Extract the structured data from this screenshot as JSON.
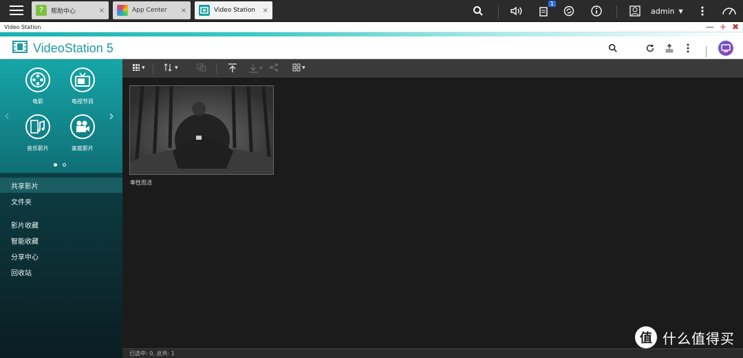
{
  "topbar": {
    "tabs": [
      {
        "label": "帮助中心",
        "close": "×",
        "icon": "help-center-icon"
      },
      {
        "label": "App Center",
        "close": "×",
        "icon": "app-center-icon"
      },
      {
        "label": "Video Station",
        "close": "×",
        "icon": "video-station-icon"
      }
    ],
    "notification_count": "1",
    "user": "admin"
  },
  "window": {
    "title": "Video Station",
    "min": "—",
    "max": "+",
    "close": "✖"
  },
  "app": {
    "title": "VideoStation 5"
  },
  "sidebar": {
    "categories": [
      {
        "label": "电影",
        "icon": "film-reel-icon"
      },
      {
        "label": "电视节目",
        "icon": "tv-icon"
      },
      {
        "label": "音乐影片",
        "icon": "music-video-icon"
      },
      {
        "label": "家庭影片",
        "icon": "video-camera-icon"
      }
    ],
    "menu": [
      {
        "label": "共享影片",
        "active": true
      },
      {
        "label": "文件夹"
      },
      {
        "label": "影片收藏"
      },
      {
        "label": "智能收藏"
      },
      {
        "label": "分享中心"
      },
      {
        "label": "回收站"
      }
    ]
  },
  "content": {
    "items": [
      {
        "caption": "率性而活"
      }
    ]
  },
  "status": {
    "text": "已选中: 0, 总共: 1"
  },
  "watermark": {
    "logo": "值",
    "text": "什么值得买"
  },
  "colors": {
    "accent": "#1e9aa6",
    "topbar": "#2b2b2b",
    "sidebar_top": "#16a6a8",
    "content_bg": "#1b1b1b"
  }
}
